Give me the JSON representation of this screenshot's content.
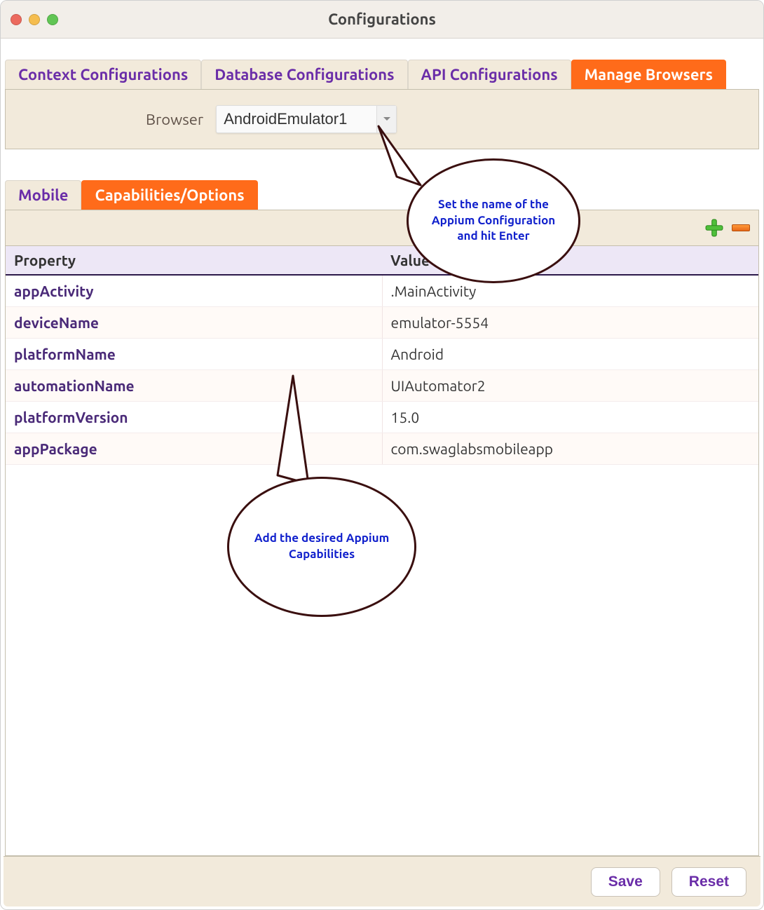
{
  "window": {
    "title": "Configurations"
  },
  "mainTabs": [
    {
      "label": "Context Configurations"
    },
    {
      "label": "Database Configurations"
    },
    {
      "label": "API Configurations"
    },
    {
      "label": "Manage Browsers"
    }
  ],
  "browser": {
    "label": "Browser",
    "value": "AndroidEmulator1"
  },
  "subTabs": [
    {
      "label": "Mobile"
    },
    {
      "label": "Capabilities/Options"
    }
  ],
  "table": {
    "headers": {
      "property": "Property",
      "value": "Value"
    },
    "rows": [
      {
        "property": "appActivity",
        "value": ".MainActivity"
      },
      {
        "property": "deviceName",
        "value": "emulator-5554"
      },
      {
        "property": "platformName",
        "value": "Android"
      },
      {
        "property": "automationName",
        "value": "UIAutomator2"
      },
      {
        "property": "platformVersion",
        "value": "15.0"
      },
      {
        "property": "appPackage",
        "value": "com.swaglabsmobileapp"
      }
    ]
  },
  "footer": {
    "save": "Save",
    "reset": "Reset"
  },
  "callouts": {
    "c1": "Set the name of the Appium Configuration and hit Enter",
    "c2": "Add the desired Appium Capabilities"
  }
}
